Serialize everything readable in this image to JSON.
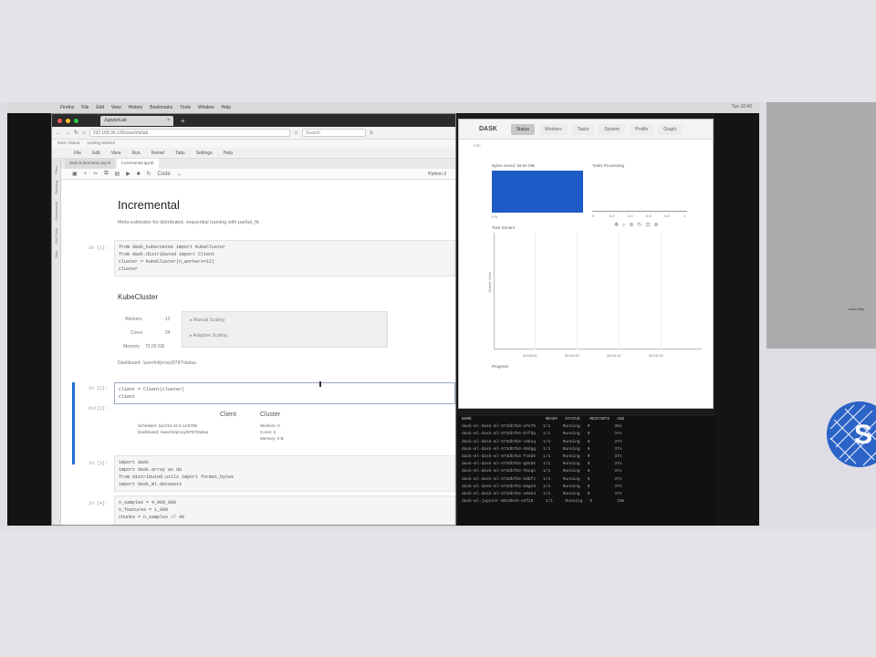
{
  "mac_menubar": {
    "items": [
      "Firefox",
      "File",
      "Edit",
      "View",
      "History",
      "Bookmarks",
      "Tools",
      "Window",
      "Help"
    ],
    "right_text": "Tue 10:42"
  },
  "browser": {
    "tab_title": "JupyterLab",
    "url": "192.168.99.100/user/ml/lab",
    "search_placeholder": "Search",
    "bookmarks": [
      "Most Visited",
      "Getting Started"
    ],
    "jupyter_menu": [
      "File",
      "Edit",
      "View",
      "Run",
      "Kernel",
      "Tabs",
      "Settings",
      "Help"
    ],
    "sidebar_tabs": [
      "Files",
      "Running",
      "Commands",
      "Cell Tools",
      "Tabs"
    ],
    "doc_tabs": [
      "dask-kubernetes.ipynb",
      "incremental.ipynb"
    ],
    "cell_type": "Code",
    "kernel_name": "Python 3"
  },
  "notebook": {
    "title": "Incremental",
    "subtitle": "Meta-estimator for distributed, sequential training with partial_fit.",
    "cell1": {
      "prompt": "In [1]:",
      "code": "from dask_kubernetes import KubeCluster\nfrom dask.distributed import Client\ncluster = KubeCluster(n_workers=12)\ncluster"
    },
    "cluster_heading": "KubeCluster",
    "workers_label": "Workers",
    "workers_value": "12",
    "cores_label": "Cores",
    "cores_value": "24",
    "memory_label": "Memory",
    "memory_value": "72.00 GB",
    "manual_scaling": "▸ Manual Scaling",
    "adaptive_scaling": "▸ Adaptive Scaling",
    "dashboard": "Dashboard: /user/ml/proxy/8787/status",
    "cell2": {
      "prompt": "In [2]:",
      "code": "client = Client(cluster)\nclient"
    },
    "out2_prompt": "Out[2]:",
    "client_heading": "Client",
    "cluster_heading2": "Cluster",
    "client_scheduler": "Scheduler: tcp://10.44.0.14:8786",
    "client_dashboard": "Dashboard: /user/ml/proxy/8787/status",
    "cluster_workers": "Workers: 0",
    "cluster_cores": "Cores: 0",
    "cluster_memory": "Memory: 0 B",
    "cell3": {
      "prompt": "In [3]:",
      "code": "import dask\nimport dask.array as da\nfrom distributed.utils import format_bytes\nimport dask_ml.datasets"
    },
    "cell4": {
      "prompt": "In [4]:",
      "code": "n_samples = 4_000_000\nn_features = 1_000\nchunks = n_samples // 40\n\nX, y = dask_ml.datasets.make_classification(\n    n_samples=n_samples, n_features=n_features,"
    }
  },
  "dask": {
    "logo": "DASK",
    "tabs": [
      "Status",
      "Workers",
      "Tasks",
      "System",
      "Profile",
      "Graph"
    ],
    "active_tab": "Status",
    "sub_label": "Info",
    "bytes_stored": "Bytes stored: 59.94 MB",
    "tasks_processing": "Tasks Processing",
    "proc_ticks": [
      "0",
      "0.2",
      "0.4",
      "0.6",
      "0.8",
      "1"
    ],
    "bytes_axis": "0 B",
    "task_stream": "Task Stream",
    "worker_core": "Worker Core",
    "stream_ticks": [
      "00:00:00",
      "00:00:05",
      "00:00:10",
      "00:00:15"
    ],
    "progress": "Progress",
    "bar_color": "#1f5bc6"
  },
  "terminal": {
    "header": "NAME                              READY   STATUS    RESTARTS   AGE",
    "rows": [
      "dask-ml-dask-ml-573db7b4-a7e7b   1/1     Running   0          38s",
      "dask-ml-dask-ml-573db7b4-b7fdp   1/1     Running   0          37s",
      "dask-ml-dask-ml-573db7b4-c5bnq   1/1     Running   0          37s",
      "dask-ml-dask-ml-573db7b4-d8dgg   1/1     Running   0          37s",
      "dask-ml-dask-ml-573db7b4-f4nbk   1/1     Running   0          37s",
      "dask-ml-dask-ml-573db7b4-g8nbk   1/1     Running   0          37s",
      "dask-ml-dask-ml-573db7b4-h5nqc   1/1     Running   0          37s",
      "dask-ml-dask-ml-573db7b4-k8bfz   1/1     Running   0          37s",
      "dask-ml-dask-ml-573db7b4-m8gz6   1/1     Running   0          37s",
      "dask-ml-dask-ml-573db7b4-s8ah4   1/1     Running   0          37s",
      "dask-ml-jupyter-85c9bc6-x5f26     1/1     Running   0          19m"
    ]
  },
  "slide": {
    "right_text": "www.nisp"
  }
}
